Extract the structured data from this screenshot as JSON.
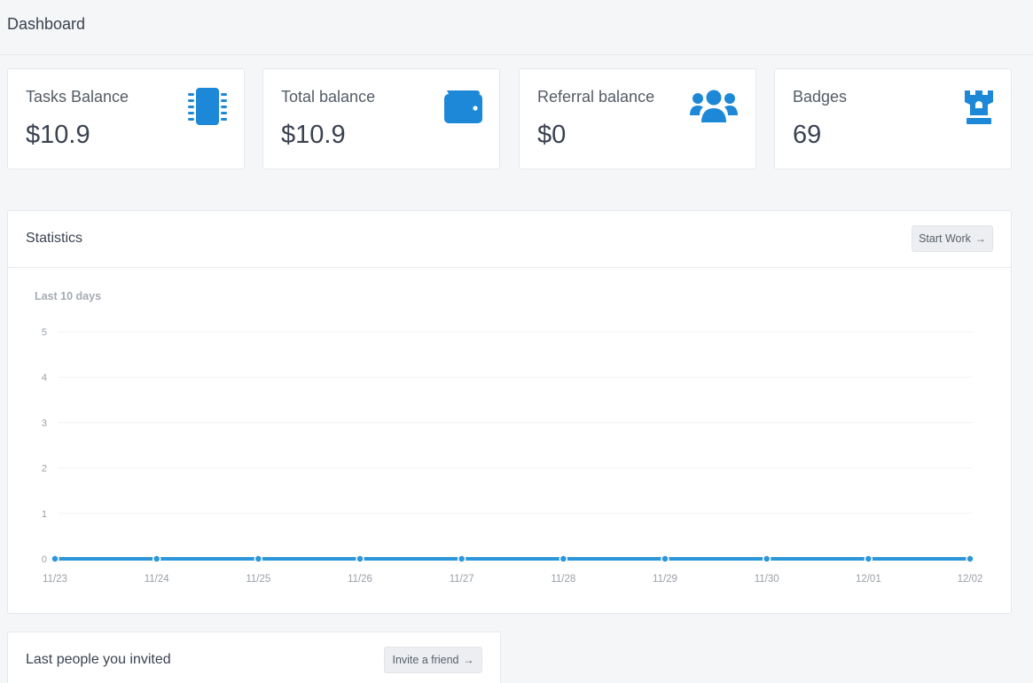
{
  "page": {
    "title": "Dashboard"
  },
  "stats": [
    {
      "label": "Tasks Balance",
      "value": "$10.9",
      "icon": "chip-icon"
    },
    {
      "label": "Total balance",
      "value": "$10.9",
      "icon": "wallet-icon"
    },
    {
      "label": "Referral balance",
      "value": "$0",
      "icon": "users-icon"
    },
    {
      "label": "Badges",
      "value": "69",
      "icon": "rook-icon"
    }
  ],
  "colors": {
    "accent": "#1e88d8",
    "line": "#2b96d9"
  },
  "statistics": {
    "title": "Statistics",
    "button_label": "Start Work",
    "subtitle": "Last 10 days"
  },
  "invited": {
    "title": "Last people you invited",
    "button_label": "Invite a friend"
  },
  "chart_data": {
    "type": "line",
    "title": "Last 10 days",
    "categories": [
      "11/23",
      "11/24",
      "11/25",
      "11/26",
      "11/27",
      "11/28",
      "11/29",
      "11/30",
      "12/01",
      "12/02"
    ],
    "series": [
      {
        "values": [
          0,
          0,
          0,
          0,
          0,
          0,
          0,
          0,
          0,
          0
        ]
      }
    ],
    "yticks": [
      0,
      1,
      2,
      3,
      4,
      5
    ],
    "ylim": [
      0,
      5
    ],
    "grid": true,
    "xlabel": "",
    "ylabel": ""
  }
}
